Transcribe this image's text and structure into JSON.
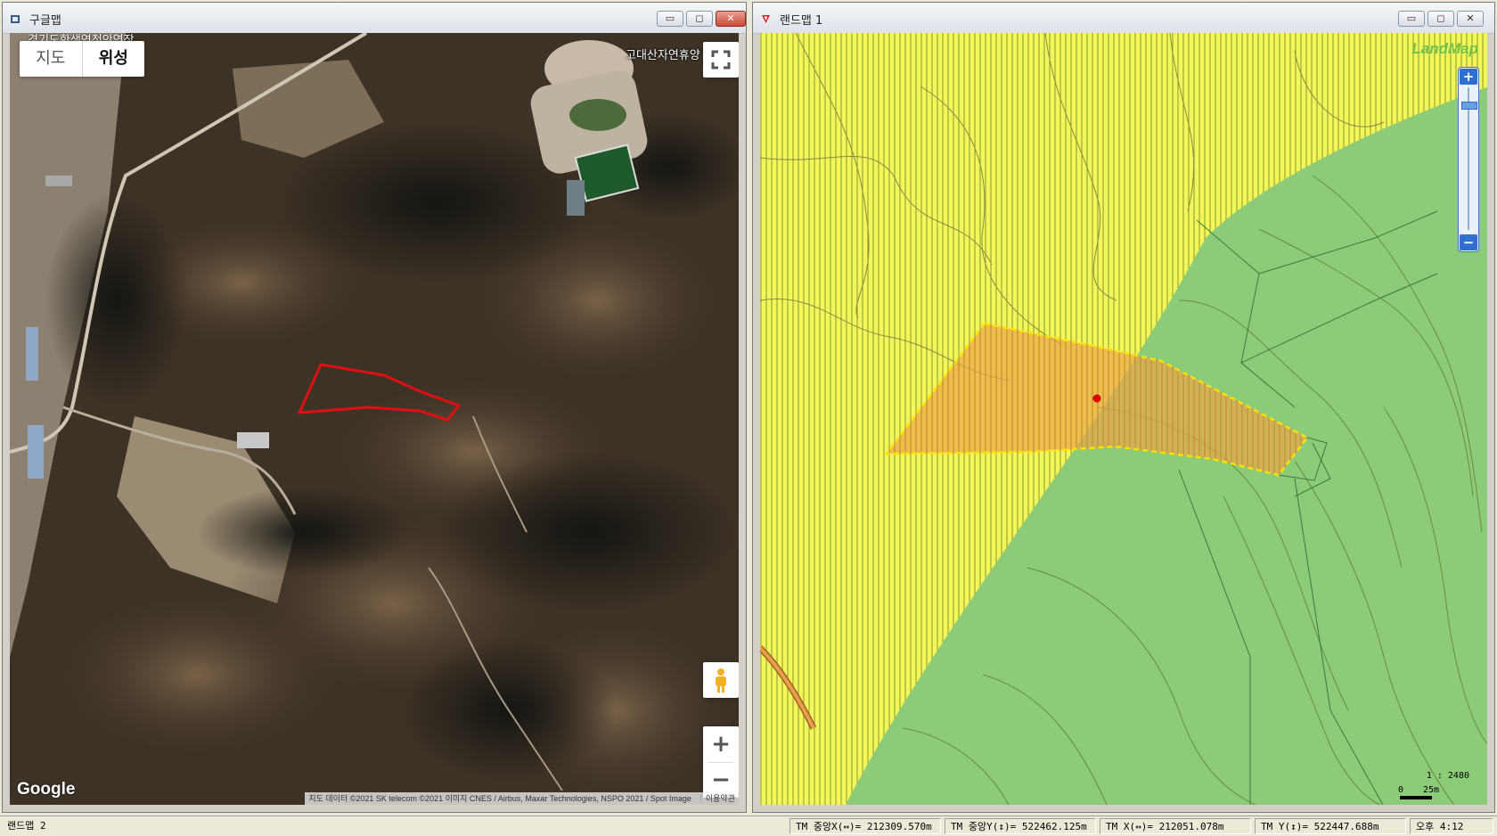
{
  "google_window": {
    "title": "구글맵",
    "controls": {
      "minimize": "▭",
      "maximize": "◻",
      "close": "✕"
    },
    "map_type": {
      "map_label": "지도",
      "satellite_label": "위성",
      "selected": "위성"
    },
    "place_labels": {
      "top": "경기도한생연청안연장",
      "park": "고대산자연휴양"
    },
    "zoom": {
      "in": "+",
      "out": "−"
    },
    "logo": "Google",
    "attribution": "지도 데이터 ©2021 SK telecom ©2021 이미지 CNES / Airbus, Maxar Technologies, NSPO 2021 / Spot Image",
    "terms": "이용약관",
    "icons": [
      "fullscreen-icon",
      "pegman-icon"
    ],
    "parcel_outline_color": "#e01010"
  },
  "landmap_window": {
    "title": "랜드맵 1",
    "controls": {
      "minimize": "▭",
      "maximize": "◻",
      "close": "✕"
    },
    "logo": "LandMap",
    "zoom": {
      "in": "+",
      "out": "−"
    },
    "scale": {
      "ratio": "1 : 2480",
      "zero": "0",
      "distance": "25m"
    },
    "colors": {
      "zone_yellow": "#f2f65a",
      "zone_green": "#8ccc78",
      "parcel_fill": "#e8a848",
      "parcel_border": "#ffe000",
      "marker": "#e00000"
    }
  },
  "status_bar": {
    "app_name": "랜드맵 2",
    "tm_center_x": "TM 중앙X(↔)= 212309.570m",
    "tm_center_y": "TM 중앙Y(↕)= 522462.125m",
    "tm_x": "TM X(↔)= 212051.078m",
    "tm_y": "TM Y(↕)= 522447.688m",
    "time": "오후 4:12"
  }
}
